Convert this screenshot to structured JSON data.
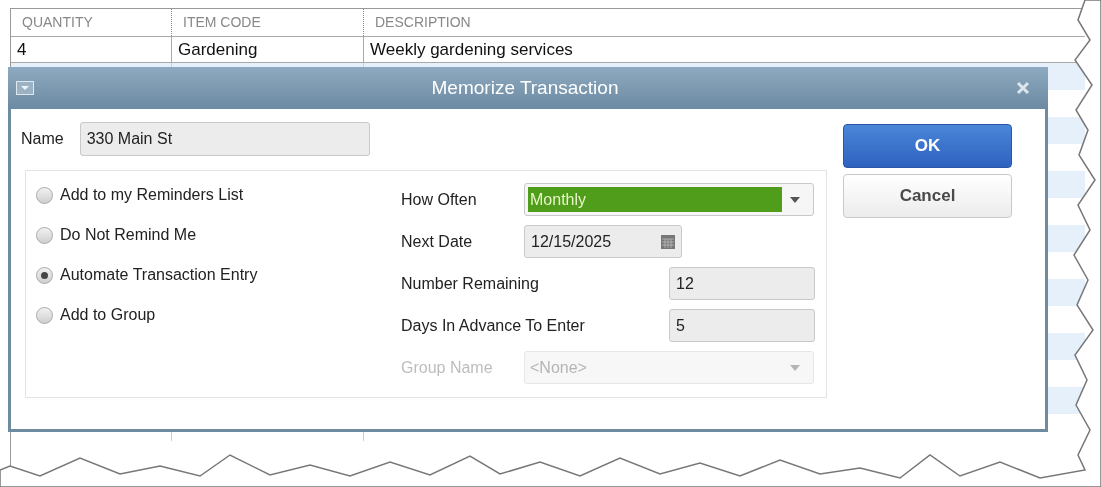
{
  "table": {
    "columns": [
      "QUANTITY",
      "ITEM CODE",
      "DESCRIPTION"
    ],
    "rows": [
      {
        "cells": [
          "4",
          "Gardening",
          "Weekly gardening services"
        ]
      }
    ]
  },
  "dialog": {
    "title": "Memorize Transaction",
    "name_label": "Name",
    "name_value": "330 Main St",
    "options": [
      {
        "label": "Add to my Reminders List",
        "selected": false
      },
      {
        "label": "Do Not Remind Me",
        "selected": false
      },
      {
        "label": "Automate Transaction Entry",
        "selected": true
      },
      {
        "label": "Add to Group",
        "selected": false
      }
    ],
    "fields": [
      {
        "kind": "dropdown",
        "label": "How Often",
        "value": "Monthly",
        "highlighted": true,
        "disabled": false
      },
      {
        "kind": "date",
        "label": "Next Date",
        "value": "12/15/2025"
      },
      {
        "kind": "number",
        "label": "Number Remaining",
        "value": "12"
      },
      {
        "kind": "number",
        "label": "Days In Advance To Enter",
        "value": "5"
      },
      {
        "kind": "dropdown",
        "label": "Group Name",
        "value": "<None>",
        "highlighted": false,
        "disabled": true
      }
    ],
    "buttons": [
      {
        "label": "OK",
        "kind": "primary"
      },
      {
        "label": "Cancel",
        "kind": "secondary"
      }
    ]
  }
}
